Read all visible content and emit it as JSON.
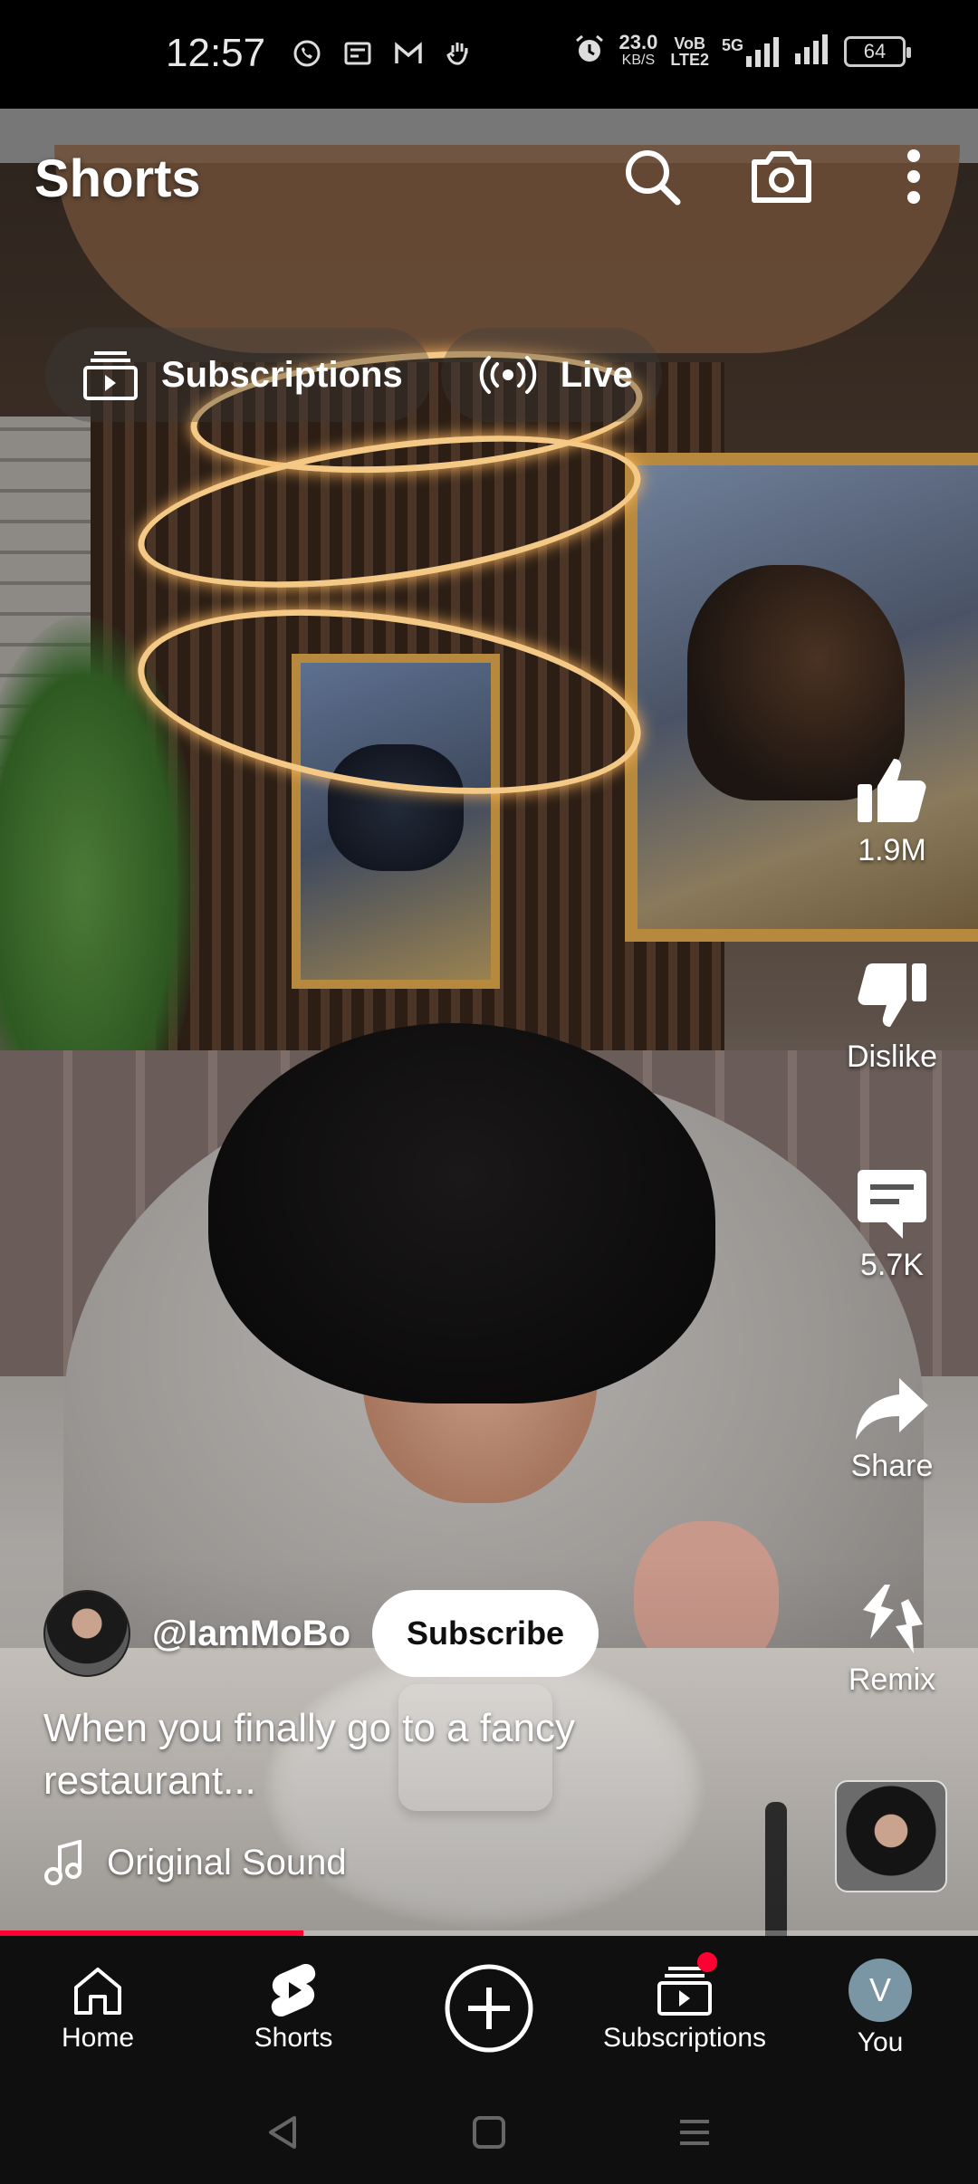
{
  "status_bar": {
    "time": "12:57",
    "net_speed_value": "23.0",
    "net_speed_unit": "KB/S",
    "volte_top": "VoB",
    "volte_bottom": "LTE2",
    "network": "5G",
    "battery": "64"
  },
  "header": {
    "title": "Shorts"
  },
  "chips": [
    {
      "label": "Subscriptions",
      "icon": "subscriptions-icon"
    },
    {
      "label": "Live",
      "icon": "live-icon"
    }
  ],
  "actions": {
    "like_count": "1.9M",
    "dislike_label": "Dislike",
    "comment_count": "5.7K",
    "share_label": "Share",
    "remix_label": "Remix"
  },
  "video": {
    "channel_handle": "@IamMoBo",
    "subscribe_label": "Subscribe",
    "caption": "When you finally go to a fancy restaurant...",
    "sound_label": "Original Sound",
    "progress": 0.31
  },
  "bottom_nav": [
    {
      "label": "Home",
      "icon": "home-icon"
    },
    {
      "label": "Shorts",
      "icon": "shorts-icon"
    },
    {
      "label": "",
      "icon": "create-icon"
    },
    {
      "label": "Subscriptions",
      "icon": "subscriptions-icon"
    },
    {
      "label": "You",
      "icon": "avatar"
    }
  ],
  "you_avatar_letter": "V",
  "colors": {
    "accent_red": "#ff0033",
    "nav_bg": "#0f0f0f"
  }
}
